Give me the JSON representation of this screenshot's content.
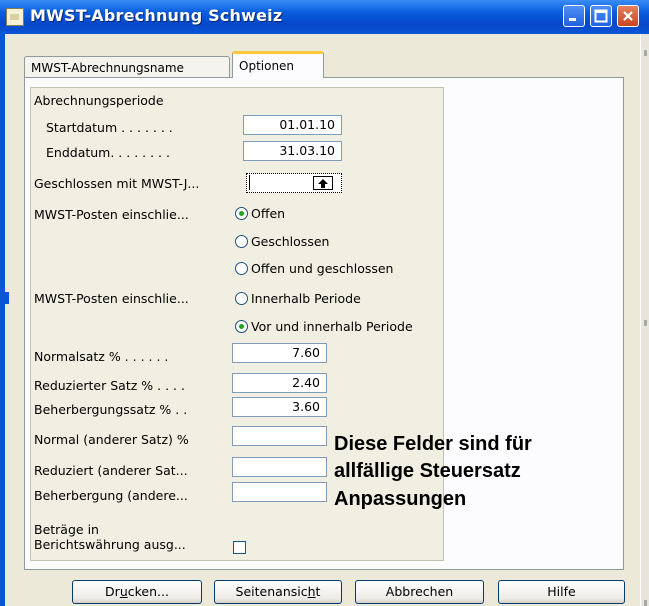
{
  "window": {
    "title": "MWST-Abrechnung Schweiz"
  },
  "tabs": [
    {
      "label": "MWST-Abrechnungsname",
      "active": false
    },
    {
      "label": "Optionen",
      "active": true
    }
  ],
  "period": {
    "heading": "Abrechnungsperiode",
    "start_label": "Startdatum . . . . . . .",
    "start_value": "01.01.10",
    "end_label": "Enddatum. . . . . . . .",
    "end_value": "31.03.10"
  },
  "closed_with": {
    "label": "Geschlossen mit MWST-J...",
    "value": ""
  },
  "posten1": {
    "label": "MWST-Posten einschlie...",
    "options": [
      "Offen",
      "Geschlossen",
      "Offen und geschlossen"
    ],
    "selected": "Offen"
  },
  "posten2": {
    "label": "MWST-Posten einschlie...",
    "options": [
      "Innerhalb Periode",
      "Vor und innerhalb Periode"
    ],
    "selected": "Vor und innerhalb Periode"
  },
  "rates": {
    "normal_label": "Normalsatz % . . . . . .",
    "normal_value": "7.60",
    "reduced_label": "Reduzierter Satz % . . . .",
    "reduced_value": "2.40",
    "lodging_label": "Beherbergungssatz % . .",
    "lodging_value": "3.60",
    "normal_other_label": "Normal (anderer Satz) %",
    "normal_other_value": "",
    "reduced_other_label": "Reduziert (anderer Sat...",
    "reduced_other_value": "",
    "lodging_other_label": "Beherbergung (andere...",
    "lodging_other_value": ""
  },
  "report_currency": {
    "label_line1": "Beträge in",
    "label_line2": "Berichtswährung ausg...",
    "checked": false
  },
  "annotation": {
    "line1": "Diese Felder sind für",
    "line2": "allfällige Steuersatz",
    "line3": "Anpassungen"
  },
  "buttons": {
    "print_pre": "Dr",
    "print_u": "u",
    "print_post": "cken...",
    "preview_pre": "Seitenansic",
    "preview_u": "h",
    "preview_post": "t",
    "cancel": "Abbrechen",
    "help": "Hilfe"
  },
  "colors": {
    "titlebar": "#0A55D6",
    "dialog_bg": "#ECE9D8",
    "active_tab_accent": "#FFC83C",
    "radio_dot": "#21A121"
  }
}
